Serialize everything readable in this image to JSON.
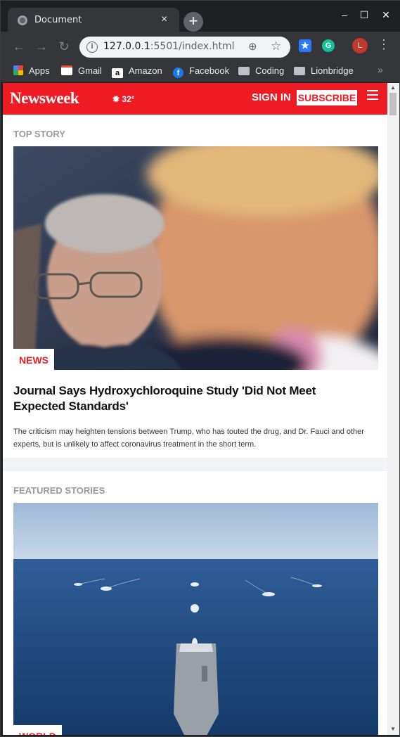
{
  "browser": {
    "tab_title": "Document",
    "tab_close": "×",
    "new_tab": "+",
    "window_controls": [
      "–",
      "☐",
      "✕"
    ],
    "url_host": "127.0.0.1",
    "url_rest": ":5501/index.html",
    "profile_initial": "L",
    "bookmarks": [
      "Apps",
      "Gmail",
      "Amazon",
      "Facebook",
      "Coding",
      "Lionbridge"
    ],
    "bookmarks_more": "»"
  },
  "site": {
    "logo": "Newsweek",
    "weather": "32°",
    "sign_in": "SIGN IN",
    "subscribe": "SUBSCRIBE >"
  },
  "top_story": {
    "section_label": "TOP STORY",
    "badge": "NEWS",
    "headline": "Journal Says Hydroxychloroquine Study 'Did Not Meet Expected Standards'",
    "summary": "The criticism may heighten tensions between Trump, who has touted the drug, and Dr. Fauci and other experts, but is unlikely to affect coronavirus treatment in the short term."
  },
  "featured": {
    "section_label": "FEATURED STORIES",
    "badge": "WORLD"
  },
  "colors": {
    "brand": "#ee1b24",
    "browser_dark": "#35363a"
  }
}
